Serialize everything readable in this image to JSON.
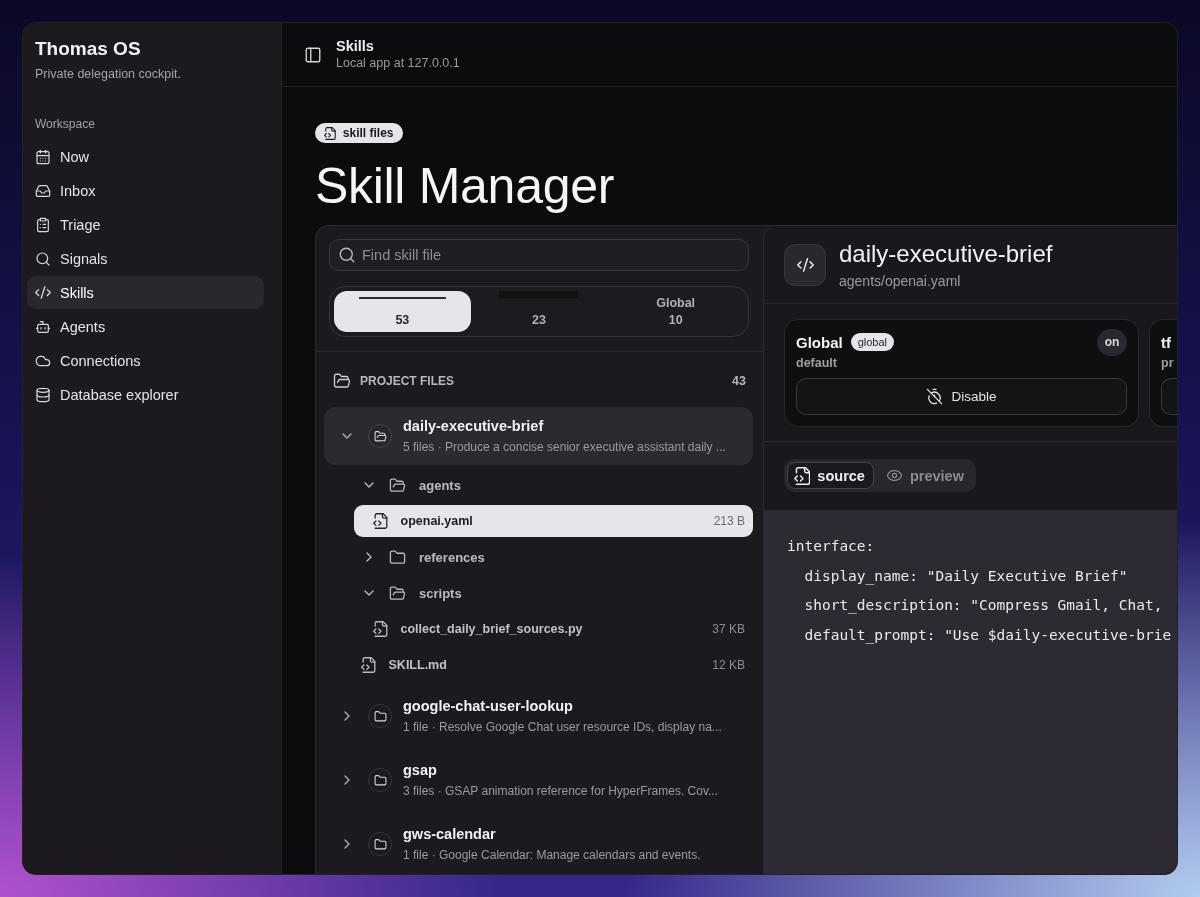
{
  "sidebar": {
    "title": "Thomas OS",
    "subtitle": "Private delegation cockpit.",
    "section": "Workspace",
    "items": [
      {
        "label": "Now",
        "selected": false
      },
      {
        "label": "Inbox",
        "selected": false
      },
      {
        "label": "Triage",
        "selected": false
      },
      {
        "label": "Signals",
        "selected": false
      },
      {
        "label": "Skills",
        "selected": true
      },
      {
        "label": "Agents",
        "selected": false
      },
      {
        "label": "Connections",
        "selected": false
      },
      {
        "label": "Database explorer",
        "selected": false
      }
    ]
  },
  "header": {
    "title": "Skills",
    "subtitle": "Local app at 127.0.0.1"
  },
  "page": {
    "tag": "skill files",
    "title": "Skill Manager"
  },
  "browser": {
    "search": {
      "placeholder": "Find skill file"
    },
    "filters": [
      {
        "kind": "line",
        "count": "53",
        "selected": true
      },
      {
        "kind": "bar",
        "count": "23",
        "selected": false
      },
      {
        "kind": "text",
        "label": "Global",
        "count": "10",
        "selected": false
      }
    ],
    "section": {
      "title": "PROJECT FILES",
      "count": "43"
    },
    "skills": [
      {
        "name": "daily-executive-brief",
        "description": "5 files · Produce a concise senior executive assistant daily ...",
        "selected": true,
        "expanded": true,
        "children": [
          {
            "kind": "folder",
            "name": "agents",
            "expanded": true,
            "children": [
              {
                "kind": "file",
                "name": "openai.yaml",
                "size": "213 B",
                "selected": true
              }
            ]
          },
          {
            "kind": "folder",
            "name": "references",
            "expanded": false
          },
          {
            "kind": "folder",
            "name": "scripts",
            "expanded": true,
            "children": [
              {
                "kind": "file",
                "name": "collect_daily_brief_sources.py",
                "size": "37 KB",
                "selected": false
              }
            ]
          },
          {
            "kind": "file",
            "name": "SKILL.md",
            "size": "12 KB",
            "selected": false
          }
        ]
      },
      {
        "name": "google-chat-user-lookup",
        "description": "1 file · Resolve Google Chat user resource IDs, display na...",
        "selected": false,
        "expanded": false
      },
      {
        "name": "gsap",
        "description": "3 files · GSAP animation reference for HyperFrames. Cov...",
        "selected": false,
        "expanded": false
      },
      {
        "name": "gws-calendar",
        "description": "1 file · Google Calendar: Manage calendars and events.",
        "selected": false,
        "expanded": false
      }
    ]
  },
  "detail": {
    "title": "daily-executive-brief",
    "path": "agents/openai.yaml",
    "scopes": [
      {
        "name": "Global",
        "badge": "global",
        "subtitle": "default",
        "status": "on",
        "action": "Disable"
      },
      {
        "name": "tf",
        "subtitle": "pr"
      }
    ],
    "view_tabs": [
      {
        "label": "source",
        "selected": true
      },
      {
        "label": "preview",
        "selected": false
      }
    ],
    "code": [
      "interface:",
      "  display_name: \"Daily Executive Brief\"",
      "  short_description: \"Compress Gmail, Chat,",
      "  default_prompt: \"Use $daily-executive-brie"
    ]
  }
}
